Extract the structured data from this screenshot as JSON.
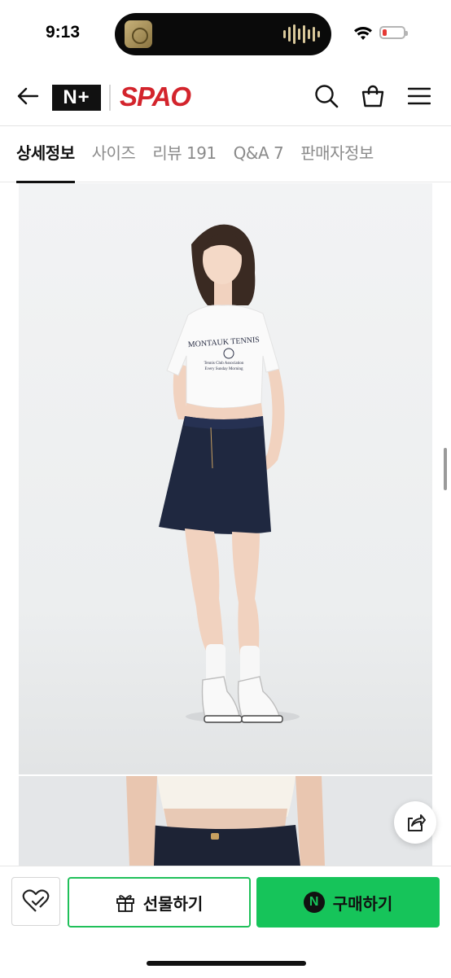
{
  "status_bar": {
    "time": "9:13"
  },
  "header": {
    "logo_badge": "N+",
    "brand": "SPAO"
  },
  "tabs": [
    {
      "label": "상세정보",
      "active": true
    },
    {
      "label": "사이즈",
      "active": false
    },
    {
      "label": "리뷰 191",
      "active": false
    },
    {
      "label": "Q&A 7",
      "active": false
    },
    {
      "label": "판매자정보",
      "active": false
    }
  ],
  "product_photo": {
    "shirt_print": [
      "MONTAUK TENNIS",
      "Tennis Club Association",
      "Every Sunday Morning"
    ]
  },
  "bottom_bar": {
    "gift_label": "선물하기",
    "buy_label": "구매하기",
    "buy_badge": "N"
  },
  "colors": {
    "brand_red": "#d3242c",
    "naver_green": "#16c45a"
  }
}
